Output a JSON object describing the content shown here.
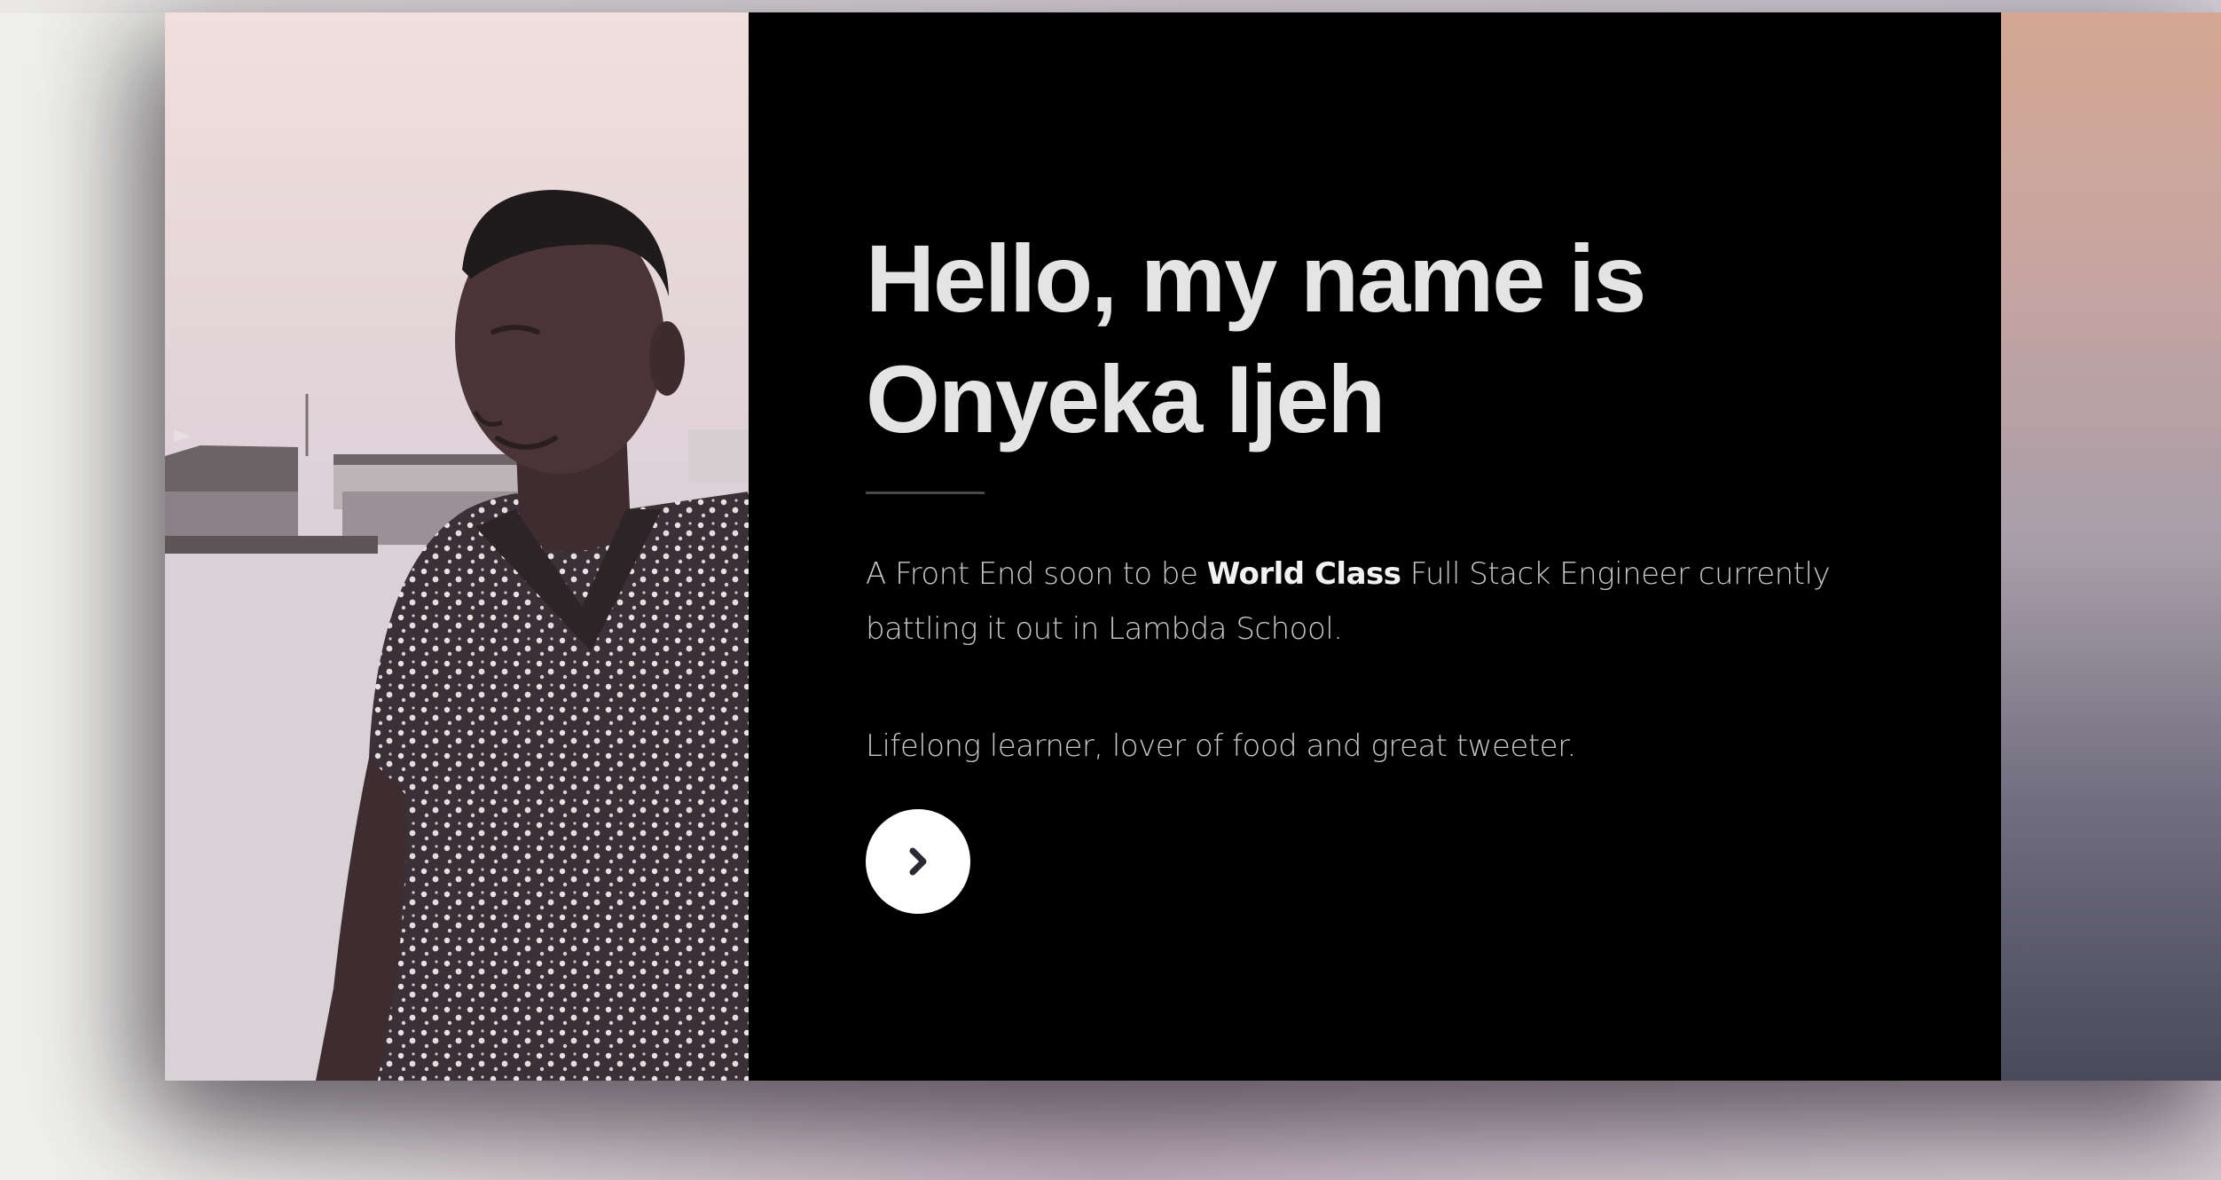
{
  "hero": {
    "headline_line1": "Hello, my name is",
    "headline_line2": "Onyeka Ijeh",
    "intro_before": "A Front End soon to be ",
    "intro_bold": "World Class",
    "intro_after": " Full Stack Engineer currently battling it out in Lambda School.",
    "tagline": "Lifelong learner, lover of food and great tweeter.",
    "next_button_icon": "chevron-right-icon"
  },
  "colors": {
    "panel_background": "#000000",
    "headline": "#e4e4e4",
    "body_text": "#c8c8c8",
    "button_background": "#ffffff",
    "button_icon": "#2a2a33"
  }
}
